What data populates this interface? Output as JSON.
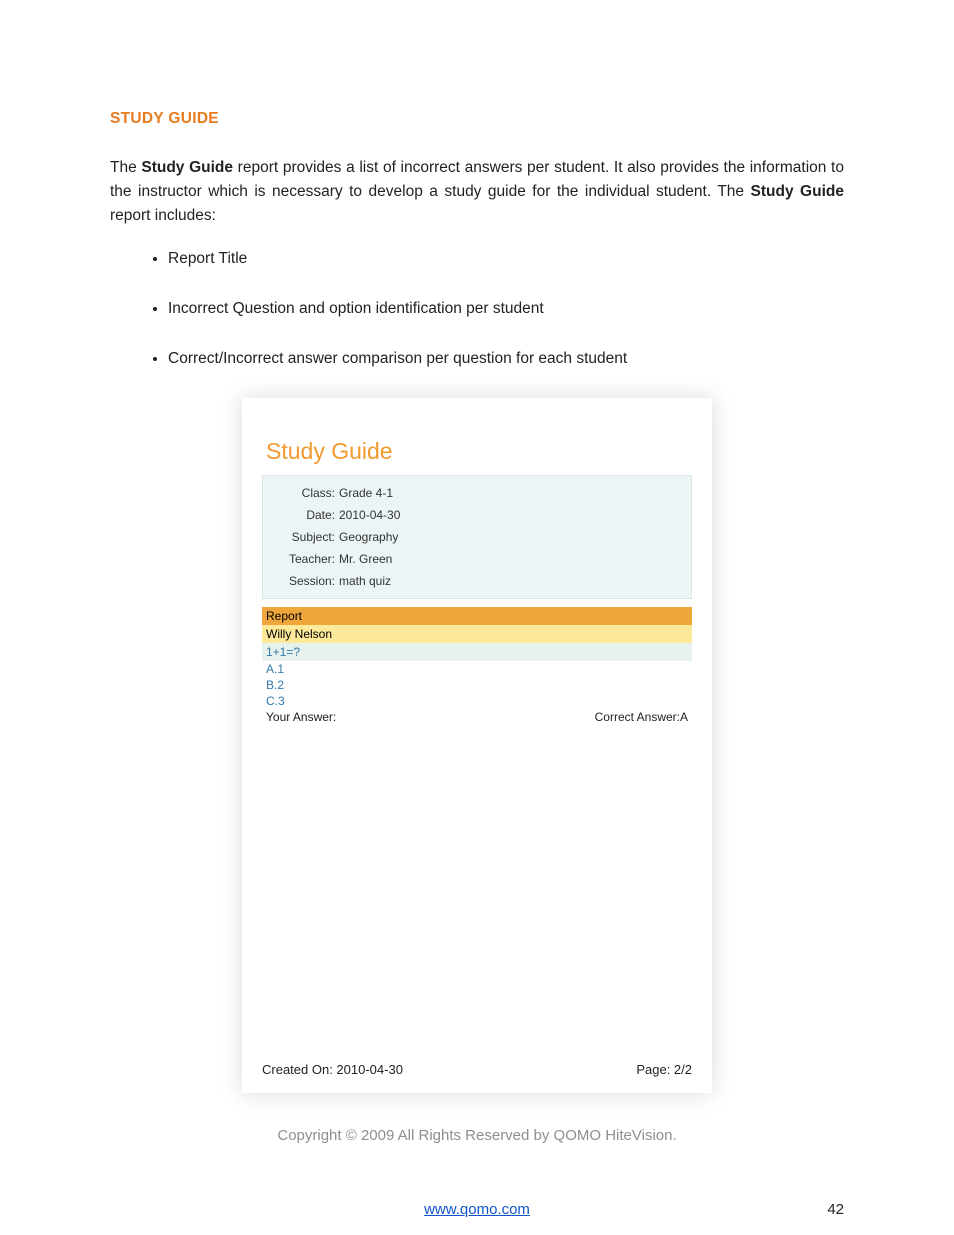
{
  "heading": "STUDY GUIDE",
  "intro": {
    "prefix": "The ",
    "bold1": "Study Guide",
    "mid": " report provides a list of incorrect answers per student. It also provides the information to the instructor which is necessary to develop a study guide for the individual student. The ",
    "bold2": "Study Guide",
    "suffix": " report includes:"
  },
  "bullets": [
    "Report Title",
    "Incorrect Question and option identification per student",
    "Correct/Incorrect answer comparison per question for each student"
  ],
  "report": {
    "title": "Study Guide",
    "meta": {
      "class_label": "Class:",
      "class_value": "Grade 4-1",
      "date_label": "Date:",
      "date_value": "2010-04-30",
      "subject_label": "Subject:",
      "subject_value": "Geography",
      "teacher_label": "Teacher:",
      "teacher_value": "Mr. Green",
      "session_label": "Session:",
      "session_value": "math quiz"
    },
    "section_header": "Report",
    "student_name": "Willy Nelson",
    "question": "1+1=?",
    "options": [
      "A.1",
      "B.2",
      "C.3"
    ],
    "your_answer_label": "Your Answer:",
    "correct_answer_label": "Correct Answer:A",
    "created_label": "Created On:  2010-04-30",
    "page_label": "Page:  2/2"
  },
  "copyright": "Copyright © 2009 All Rights Reserved by QOMO HiteVision.",
  "footer_link": "www.qomo.com",
  "page_number": "42"
}
